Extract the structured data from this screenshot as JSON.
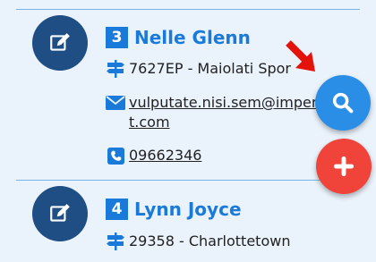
{
  "contacts": [
    {
      "number": "3",
      "name": "Nelle Glenn",
      "address": "7627EP - Maiolati Spor",
      "email": "vulputate.nisi.sem@imperdiet.com",
      "phone": "09662346"
    },
    {
      "number": "4",
      "name": "Lynn Joyce",
      "address": "29358 - Charlottetown"
    }
  ],
  "icons": {
    "edit": "edit-icon",
    "address": "signpost-icon",
    "email": "envelope-icon",
    "phone": "phone-icon",
    "search": "search-icon",
    "add": "plus-icon"
  },
  "colors": {
    "background": "#eaf2fb",
    "primary": "#1a7ad9",
    "avatar": "#1f4e85",
    "search_fab": "#2b8ee6",
    "add_fab": "#f0433a",
    "arrow": "#e3120b"
  }
}
